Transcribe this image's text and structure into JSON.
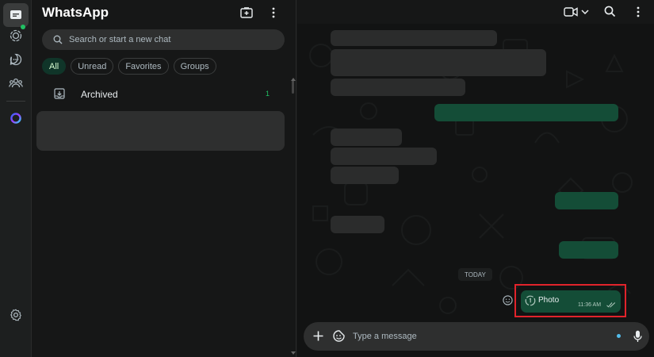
{
  "app": {
    "title": "WhatsApp"
  },
  "colors": {
    "accent_green": "#21c063",
    "outgoing_bubble": "#144d37",
    "incoming_bubble": "#2b2c2c",
    "highlight_border": "#e1232b",
    "panel_bg": "#161717"
  },
  "rail": {
    "items": [
      {
        "icon": "chats-icon",
        "active": true
      },
      {
        "icon": "status-icon",
        "badge": true
      },
      {
        "icon": "channels-icon"
      },
      {
        "icon": "communities-icon"
      },
      {
        "icon": "meta-ai-icon"
      }
    ],
    "settings_icon": "gear-icon"
  },
  "chat_list": {
    "header_icons": [
      "new-chat-icon",
      "menu-icon"
    ],
    "search": {
      "placeholder": "Search or start a new chat"
    },
    "filters": [
      "All",
      "Unread",
      "Favorites",
      "Groups"
    ],
    "active_filter": "All",
    "archived": {
      "label": "Archived",
      "count": "1"
    }
  },
  "conversation": {
    "header_icons": [
      "video-call-icon",
      "chevron-down-icon",
      "search-icon",
      "menu-icon"
    ],
    "date_divider": "TODAY",
    "last_message": {
      "type_icon": "view-once-icon",
      "label": "Photo",
      "time": "11:36 AM",
      "status": "read"
    },
    "composer": {
      "placeholder": "Type a message",
      "icons": [
        "plus-icon",
        "sticker-icon",
        "mic-icon"
      ]
    }
  }
}
